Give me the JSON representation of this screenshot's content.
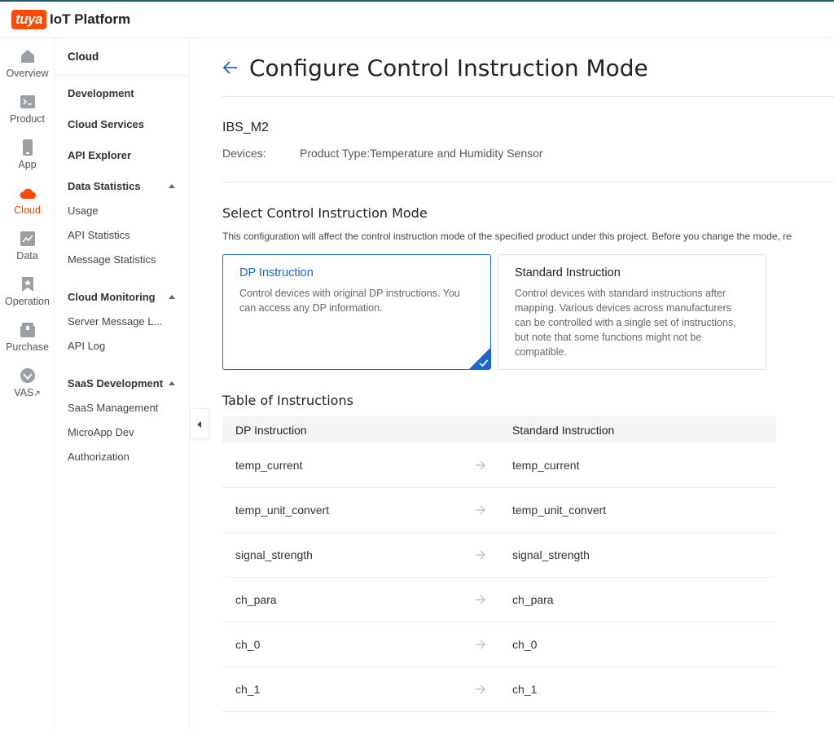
{
  "header": {
    "logo_text": "tuya",
    "app_title": "IoT Platform",
    "accent": "#ff4800"
  },
  "rail": {
    "items": [
      {
        "label": "Overview",
        "icon": "home-icon"
      },
      {
        "label": "Product",
        "icon": "terminal-icon"
      },
      {
        "label": "App",
        "icon": "phone-icon"
      },
      {
        "label": "Cloud",
        "icon": "cloud-icon",
        "active": true
      },
      {
        "label": "Data",
        "icon": "chart-icon"
      },
      {
        "label": "Operation",
        "icon": "bookmark-icon"
      },
      {
        "label": "Purchase",
        "icon": "box-icon"
      },
      {
        "label": "VAS",
        "icon": "diamond-icon",
        "external": "↗"
      }
    ]
  },
  "sidebar": {
    "header": "Cloud",
    "development": "Development",
    "cloud_services": "Cloud Services",
    "api_explorer": "API Explorer",
    "data_statistics": "Data Statistics",
    "usage": "Usage",
    "api_statistics": "API Statistics",
    "message_statistics": "Message Statistics",
    "cloud_monitoring": "Cloud Monitoring",
    "server_message": "Server Message L...",
    "api_log": "API Log",
    "saas_development": "SaaS Development",
    "saas_management": "SaaS Management",
    "microapp_dev": "MicroApp Dev",
    "authorization": "Authorization"
  },
  "main": {
    "title": "Configure Control Instruction Mode",
    "product_name": "IBS_M2",
    "devices_label": "Devices:",
    "product_type": "Product Type:Temperature and Humidity Sensor",
    "select_title": "Select Control Instruction Mode",
    "select_desc": "This configuration will affect the control instruction mode of the specified product under this project. Before you change the mode, re",
    "cards": [
      {
        "title": "DP Instruction",
        "desc": "Control devices with original DP instructions. You can access any DP information.",
        "selected": true
      },
      {
        "title": "Standard Instruction",
        "desc": "Control devices with standard instructions after mapping. Various devices across manufacturers can be controlled with a single set of instructions, but note that some functions might not be compatible.",
        "selected": false
      }
    ],
    "table_title": "Table of Instructions",
    "table": {
      "headers": [
        "DP Instruction",
        "Standard Instruction"
      ],
      "rows": [
        [
          "temp_current",
          "temp_current"
        ],
        [
          "temp_unit_convert",
          "temp_unit_convert"
        ],
        [
          "signal_strength",
          "signal_strength"
        ],
        [
          "ch_para",
          "ch_para"
        ],
        [
          "ch_0",
          "ch_0"
        ],
        [
          "ch_1",
          "ch_1"
        ]
      ]
    }
  },
  "colors": {
    "primary": "#1a66d6",
    "brand": "#ff4800"
  }
}
